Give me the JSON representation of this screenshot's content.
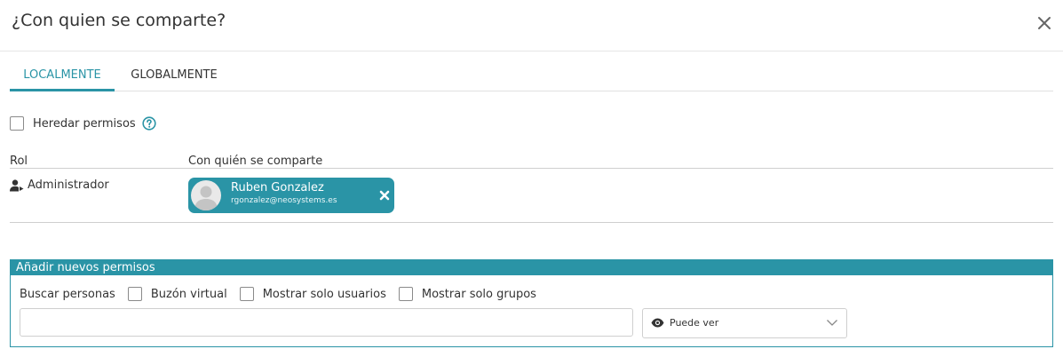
{
  "dialog": {
    "title": "¿Con quien se comparte?",
    "close_icon": "close-icon"
  },
  "tabs": [
    {
      "label": "LOCALMENTE",
      "active": true
    },
    {
      "label": "GLOBALMENTE",
      "active": false
    }
  ],
  "inherit": {
    "label": "Heredar permisos",
    "checked": false,
    "help_icon": "help-circle-icon"
  },
  "table": {
    "headers": [
      "Rol",
      "Con quién se comparte"
    ],
    "rows": [
      {
        "role": "Administrador",
        "role_icon": "user-share-icon",
        "shared_with": {
          "name": "Ruben Gonzalez",
          "email": "rgonzalez@neosystems.es"
        }
      }
    ]
  },
  "add_panel": {
    "title": "Añadir nuevos permisos",
    "search_label": "Buscar personas",
    "options": [
      {
        "label": "Buzón virtual",
        "checked": false
      },
      {
        "label": "Mostrar solo usuarios",
        "checked": false
      },
      {
        "label": "Mostrar solo grupos",
        "checked": false
      }
    ],
    "search_value": "",
    "permission": {
      "selected": "Puede ver",
      "icon": "eye-icon"
    }
  },
  "colors": {
    "accent": "#2a94a6",
    "text": "#333333",
    "border": "#cfcfcf"
  }
}
